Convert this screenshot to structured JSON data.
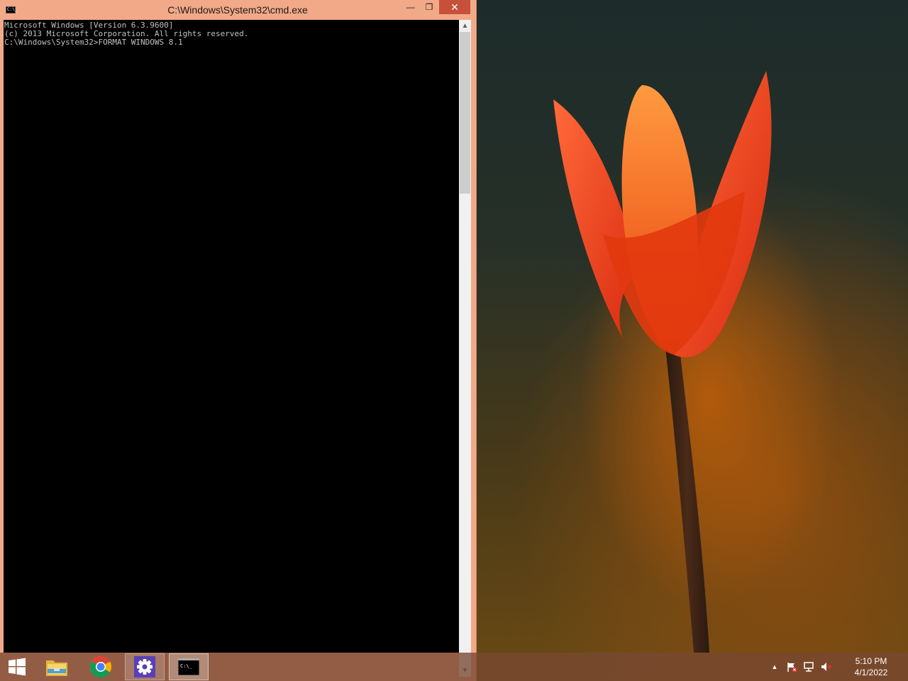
{
  "window": {
    "title": "C:\\Windows\\System32\\cmd.exe",
    "icon_text": "C:\\_",
    "minimize_glyph": "—",
    "restore_glyph": "❐",
    "close_glyph": "✕"
  },
  "console": {
    "lines": [
      "Microsoft Windows [Version 6.3.9600]",
      "(c) 2013 Microsoft Corporation. All rights reserved.",
      "",
      "C:\\Windows\\System32>FORMAT WINDOWS 8.1"
    ]
  },
  "scrollbar": {
    "up_glyph": "▲",
    "down_glyph": "▼"
  },
  "taskbar": {
    "items": [
      {
        "name": "start-button",
        "icon": "windows-logo-icon"
      },
      {
        "name": "explorer-button",
        "icon": "file-explorer-icon"
      },
      {
        "name": "chrome-button",
        "icon": "chrome-icon"
      },
      {
        "name": "settings-button",
        "icon": "gear-icon"
      },
      {
        "name": "cmd-task-button",
        "icon": "command-prompt-icon"
      }
    ],
    "cmd_icon_text": "C:\\_"
  },
  "tray": {
    "chevron_glyph": "▲",
    "time": "5:10 PM",
    "date": "4/1/2022"
  },
  "colors": {
    "window_frame": "#f2a987",
    "close_button": "#c7503a",
    "taskbar": "#784832",
    "settings_icon_bg": "#5b3fb5"
  }
}
